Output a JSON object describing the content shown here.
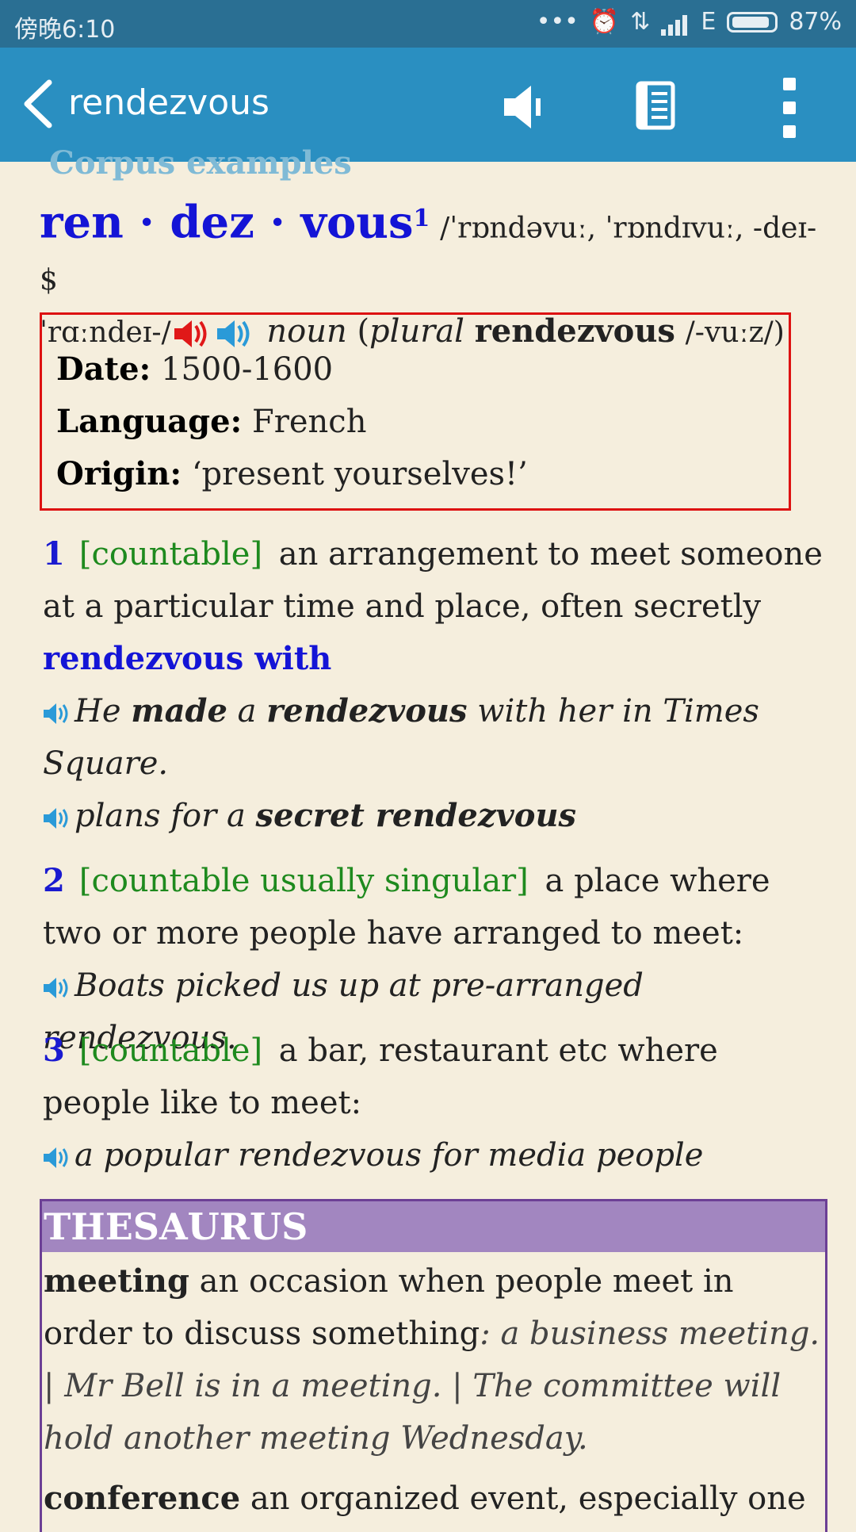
{
  "status_bar": {
    "time": "傍晚6:10",
    "network": "E",
    "battery": "87%"
  },
  "app_bar": {
    "title": "rendezvous",
    "icons": [
      "back-arrow-icon",
      "speaker-icon",
      "list-icon",
      "more-vert-icon"
    ]
  },
  "corpus_link": "Corpus examples",
  "entry": {
    "headword": "ren · dez · vous",
    "homograph": "1",
    "pronunciation_1": "/ˈrɒndəvuː, ˈrɒndɪvuː, -deɪ- $",
    "pronunciation_2": "ˈrɑːndeɪ-/",
    "pos": "noun",
    "plural_open": "(",
    "plural_label": "plural",
    "plural_form": "rendezvous",
    "plural_pron": "/-vuːz/)"
  },
  "origin": {
    "date_label": "Date:",
    "date": "1500-1600",
    "language_label": "Language:",
    "language": "French",
    "origin_label": "Origin:",
    "origin": "‘present yourselves!’"
  },
  "senses": [
    {
      "num": "1",
      "grammar": "[countable]",
      "definition": "an arrangement to meet someone at a particular time and place, often secretly",
      "collocation": "rendezvous with",
      "examples": [
        {
          "pre": "He ",
          "b1": "made",
          "mid1": " a ",
          "b2": "rendezvous",
          "post": " with her in Times Square."
        },
        {
          "pre": "plans for a ",
          "b1": "secret rendezvous"
        }
      ]
    },
    {
      "num": "2",
      "grammar": "[countable usually singular]",
      "definition": "a place where two or more people have arranged to meet:",
      "example": "Boats picked us up at pre-arranged rendezvous."
    },
    {
      "num": "3",
      "grammar": "[countable]",
      "definition": "a bar, restaurant etc where people like to meet:",
      "example": "a popular rendezvous for media people"
    }
  ],
  "thesaurus": {
    "heading": "THESAURUS",
    "items": [
      {
        "word": "meeting",
        "definition": "an occasion when people meet in order to discuss something",
        "examples": ": a business meeting. | Mr Bell is in a meeting. | The committee will hold another meeting Wednesday."
      },
      {
        "word": "conference",
        "definition": "an organized event, especially one"
      }
    ]
  },
  "colors": {
    "app_bar": "#2a8fc1",
    "status_bar": "#2a6f93",
    "headword": "#1414d6",
    "grammar": "#1e8a1e",
    "origin_border": "#d11111",
    "thesaurus_head": "#a286c0",
    "page_bg": "#f5eedd"
  }
}
